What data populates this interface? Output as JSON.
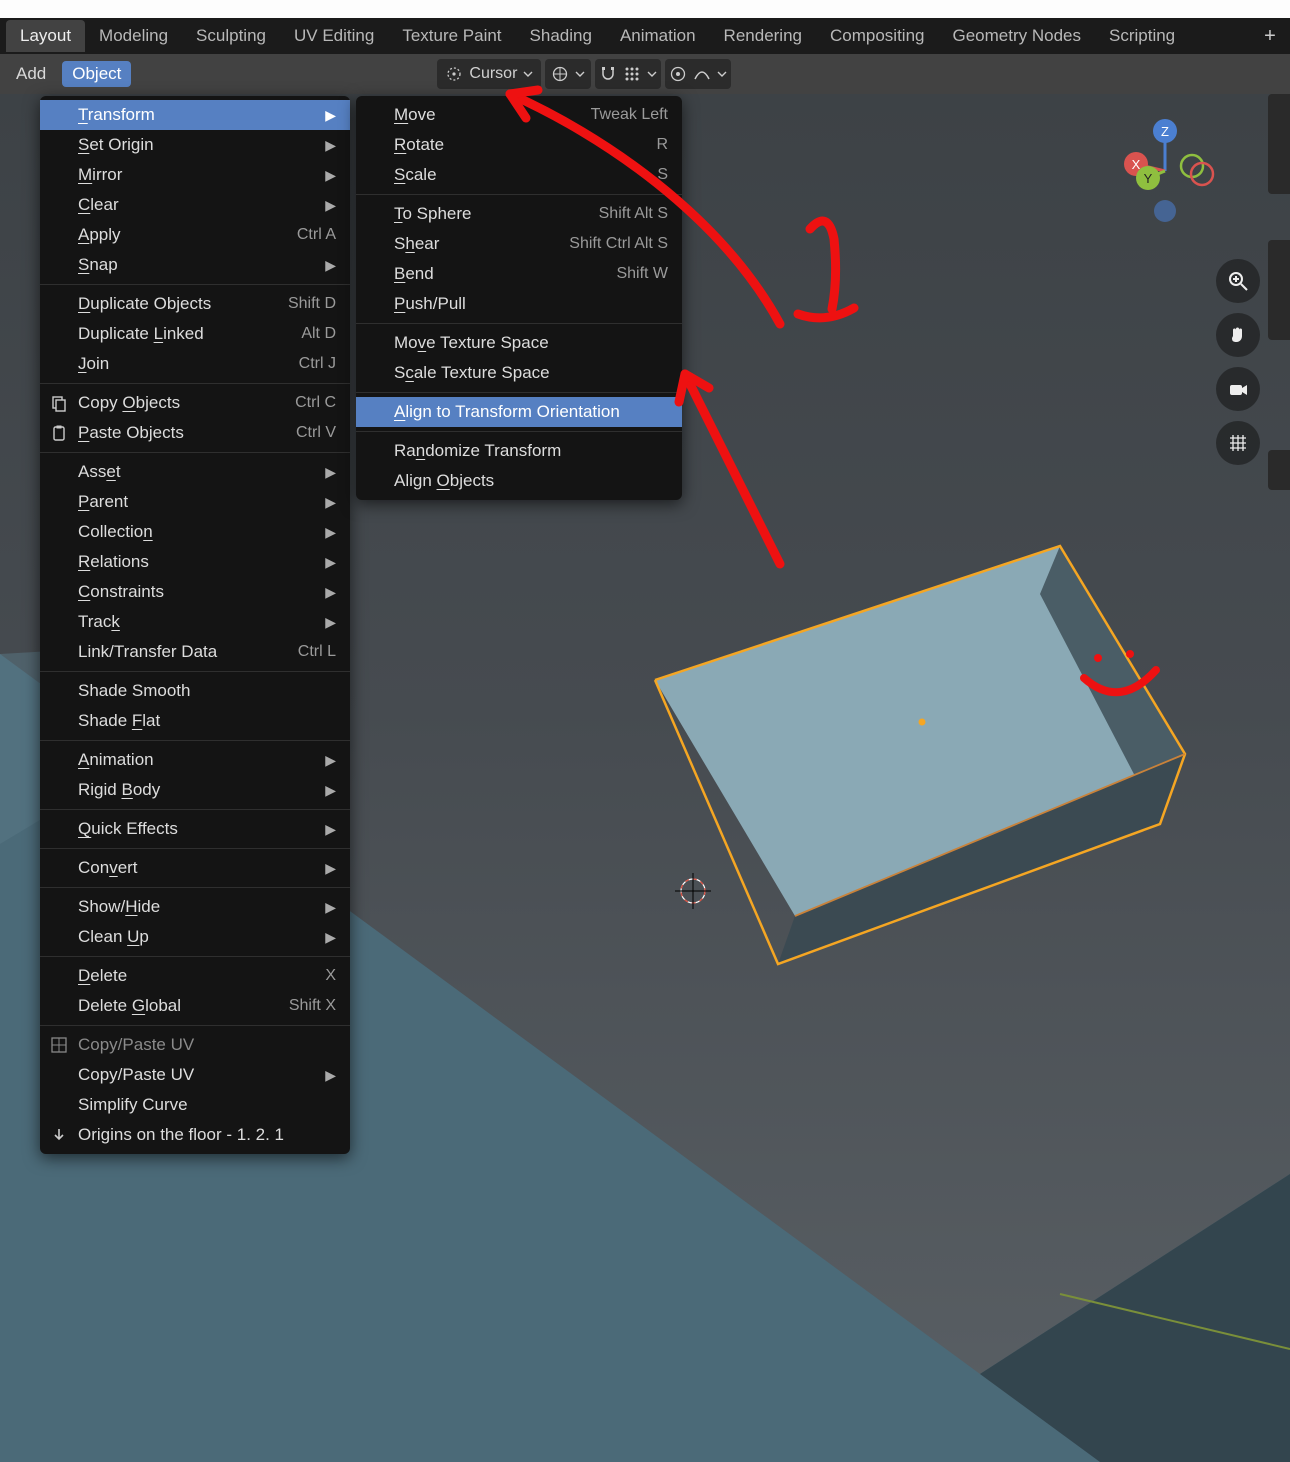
{
  "workspace_tabs": [
    "Layout",
    "Modeling",
    "Sculpting",
    "UV Editing",
    "Texture Paint",
    "Shading",
    "Animation",
    "Rendering",
    "Compositing",
    "Geometry Nodes",
    "Scripting"
  ],
  "active_workspace": 0,
  "header": {
    "add": "Add",
    "object": "Object"
  },
  "pivot": {
    "label": "Cursor"
  },
  "gizmo_axes": {
    "x": "X",
    "y": "Y",
    "z": "Z"
  },
  "annotation_number": "1",
  "object_menu": {
    "items": [
      {
        "label": "Transform",
        "ul": "T",
        "sub": true,
        "hi": true
      },
      {
        "label": "Set Origin",
        "ul": "S",
        "sub": true
      },
      {
        "label": "Mirror",
        "ul": "M",
        "sub": true
      },
      {
        "label": "Clear",
        "ul": "C",
        "sub": true
      },
      {
        "label": "Apply",
        "ul": "A",
        "shortcut": "Ctrl A",
        "sub": true
      },
      {
        "label": "Snap",
        "ul": "S",
        "sub": true
      },
      {
        "sep": true
      },
      {
        "label": "Duplicate Objects",
        "ul": "D",
        "shortcut": "Shift D"
      },
      {
        "label": "Duplicate Linked",
        "ul": "L",
        "shortcut": "Alt D"
      },
      {
        "label": "Join",
        "ul": "J",
        "shortcut": "Ctrl J"
      },
      {
        "sep": true
      },
      {
        "label": "Copy Objects",
        "ul": "O",
        "shortcut": "Ctrl C",
        "icon": "copy"
      },
      {
        "label": "Paste Objects",
        "ul": "P",
        "shortcut": "Ctrl V",
        "icon": "paste"
      },
      {
        "sep": true
      },
      {
        "label": "Asset",
        "ul": "e",
        "sub": true
      },
      {
        "label": "Parent",
        "ul": "P",
        "sub": true
      },
      {
        "label": "Collection",
        "ul": "n",
        "sub": true
      },
      {
        "label": "Relations",
        "ul": "R",
        "sub": true
      },
      {
        "label": "Constraints",
        "ul": "C",
        "sub": true
      },
      {
        "label": "Track",
        "ul": "k",
        "sub": true
      },
      {
        "label": "Link/Transfer Data",
        "shortcut": "Ctrl L",
        "sub": true
      },
      {
        "sep": true
      },
      {
        "label": "Shade Smooth"
      },
      {
        "label": "Shade Flat",
        "ul": "F"
      },
      {
        "sep": true
      },
      {
        "label": "Animation",
        "ul": "A",
        "sub": true
      },
      {
        "label": "Rigid Body",
        "ul": "B",
        "sub": true
      },
      {
        "sep": true
      },
      {
        "label": "Quick Effects",
        "ul": "Q",
        "sub": true
      },
      {
        "sep": true
      },
      {
        "label": "Convert",
        "ul": "v",
        "sub": true
      },
      {
        "sep": true
      },
      {
        "label": "Show/Hide",
        "ul": "H",
        "sub": true
      },
      {
        "label": "Clean Up",
        "ul": "U",
        "sub": true
      },
      {
        "sep": true
      },
      {
        "label": "Delete",
        "ul": "D",
        "shortcut": "X"
      },
      {
        "label": "Delete Global",
        "ul": "G",
        "shortcut": "Shift X"
      },
      {
        "sep": true
      },
      {
        "label": "Copy/Paste UV",
        "dim": true,
        "icon": "uv"
      },
      {
        "label": "Copy/Paste UV",
        "sub": true
      },
      {
        "label": "Simplify Curve"
      },
      {
        "label": "Origins on the floor - 1. 2. 1",
        "icon": "down"
      }
    ]
  },
  "transform_submenu": {
    "items": [
      {
        "label": "Move",
        "ul": "M",
        "shortcut": "Tweak Left"
      },
      {
        "label": "Rotate",
        "ul": "R",
        "shortcut": "R"
      },
      {
        "label": "Scale",
        "ul": "S",
        "shortcut": "S"
      },
      {
        "sep": true
      },
      {
        "label": "To Sphere",
        "ul": "T",
        "shortcut": "Shift Alt S"
      },
      {
        "label": "Shear",
        "ul": "h",
        "shortcut": "Shift Ctrl Alt S"
      },
      {
        "label": "Bend",
        "ul": "B",
        "shortcut": "Shift W"
      },
      {
        "label": "Push/Pull",
        "ul": "P"
      },
      {
        "sep": true
      },
      {
        "label": "Move Texture Space",
        "ul": "v"
      },
      {
        "label": "Scale Texture Space",
        "ul": "c"
      },
      {
        "sep": true
      },
      {
        "label": "Align to Transform Orientation",
        "ul": "A",
        "hi": true
      },
      {
        "sep": true
      },
      {
        "label": "Randomize Transform",
        "ul": "n"
      },
      {
        "label": "Align Objects",
        "ul": "O"
      }
    ]
  }
}
